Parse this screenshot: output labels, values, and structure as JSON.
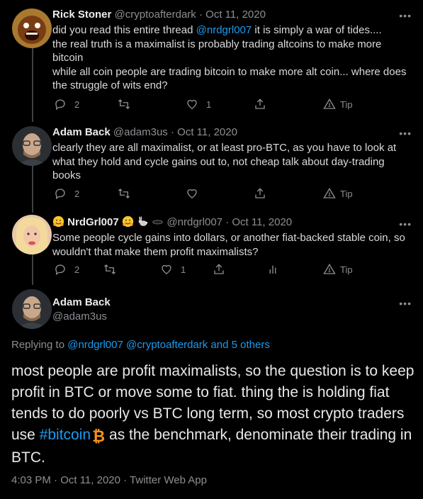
{
  "tweets": [
    {
      "name": "Rick Stoner",
      "handle": "@cryptoafterdark",
      "date": "Oct 11, 2020",
      "text_parts": [
        "did you read this entire thread ",
        "@nrdgrl007",
        " it is simply a war of tides....\nthe real truth is a maximalist is probably trading altcoins to make more bitcoin\nwhile all coin people are trading bitcoin to make more alt coin...  where does the struggle of wits end?"
      ],
      "replies": "2",
      "retweets": "",
      "likes": "1",
      "tip": "Tip"
    },
    {
      "name": "Adam Back",
      "handle": "@adam3us",
      "date": "Oct 11, 2020",
      "text": "clearly they are all maximalist, or at least pro-BTC, as you have to look at what they hold and cycle gains out to, not cheap talk about day-trading books",
      "replies": "2",
      "retweets": "",
      "likes": "",
      "tip": "Tip"
    },
    {
      "name": "NrdGrl007",
      "handle": "@nrdgrl007",
      "date": "Oct 11, 2020",
      "text": "Some people cycle gains into dollars, or another fiat-backed stable coin, so wouldn't that make them profit maximalists?",
      "replies": "2",
      "retweets": "",
      "likes": "1",
      "tip": "Tip"
    }
  ],
  "main_tweet": {
    "name": "Adam Back",
    "handle": "@adam3us",
    "replying_prefix": "Replying to ",
    "replying_users": "@nrdgrl007 @cryptoafterdark and 5 others",
    "text_before": "most people are profit maximalists, so the question is to keep profit in BTC or move some to fiat. thing the is holding fiat tends to do poorly vs BTC long term, so most crypto traders use ",
    "hashtag": "#bitcoin",
    "btc_symbol": "₿",
    "text_after": "as the benchmark, denominate their trading in BTC.",
    "footer": "4:03 PM · Oct 11, 2020 · Twitter Web App"
  },
  "ui": {
    "more": "•••",
    "dot": "·"
  },
  "colors": {
    "background": "#000000",
    "link": "#1d9bf0",
    "muted": "#8b8f93",
    "btc": "#f7931a"
  }
}
